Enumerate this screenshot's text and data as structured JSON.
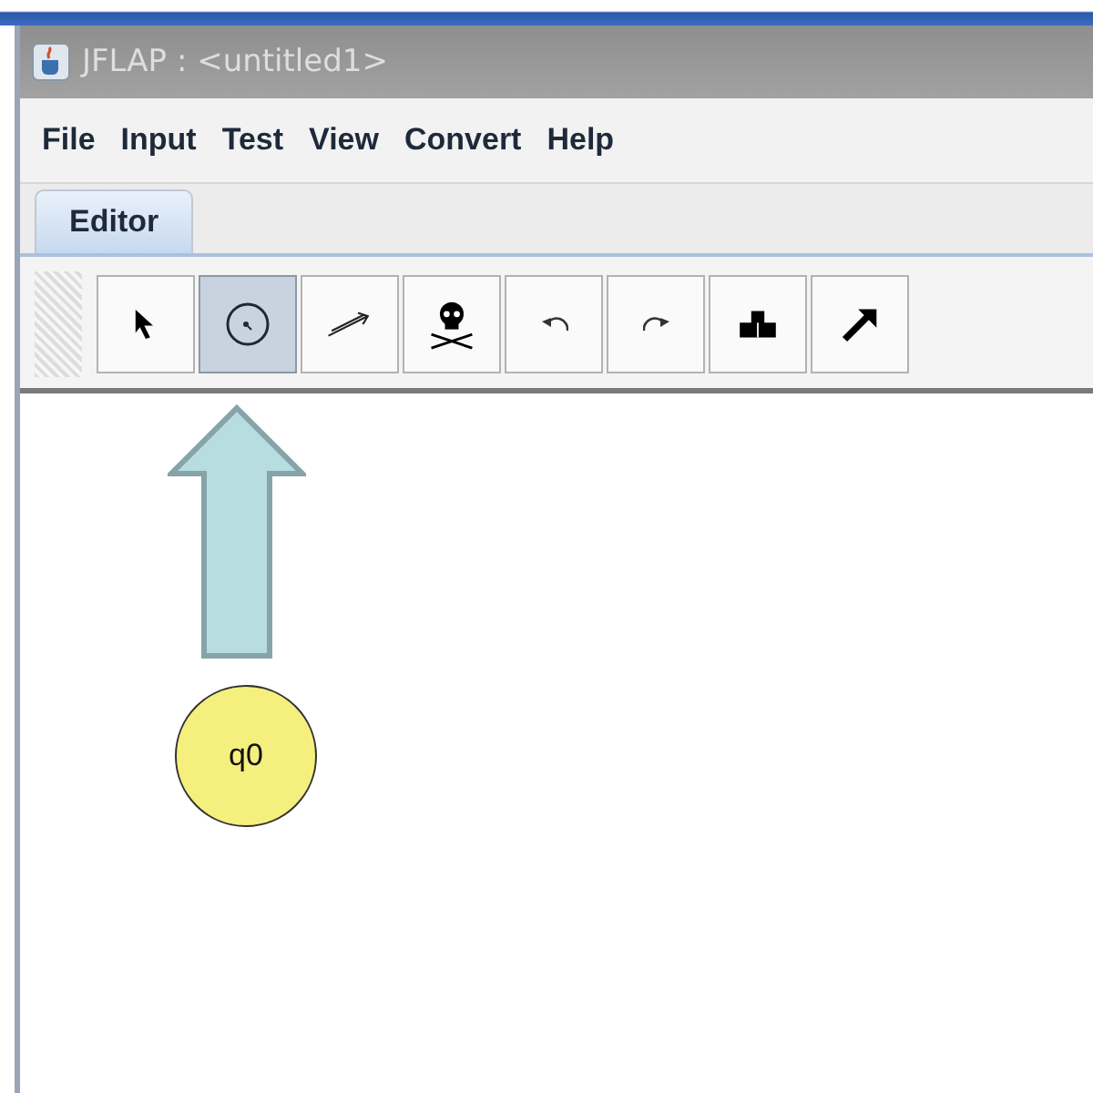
{
  "window": {
    "title": "JFLAP : <untitled1>"
  },
  "menu": [
    "File",
    "Input",
    "Test",
    "View",
    "Convert",
    "Help"
  ],
  "tabs": [
    {
      "label": "Editor",
      "selected": true
    }
  ],
  "toolbar": [
    {
      "kind": "pointer",
      "selected": false
    },
    {
      "kind": "state",
      "selected": true
    },
    {
      "kind": "transition",
      "selected": false
    },
    {
      "kind": "skull",
      "selected": false
    },
    {
      "kind": "undo",
      "selected": false
    },
    {
      "kind": "redo",
      "selected": false
    },
    {
      "kind": "blocks",
      "selected": false
    },
    {
      "kind": "diagonal",
      "selected": false
    }
  ],
  "canvas": {
    "states": [
      {
        "label": "q0"
      }
    ]
  }
}
